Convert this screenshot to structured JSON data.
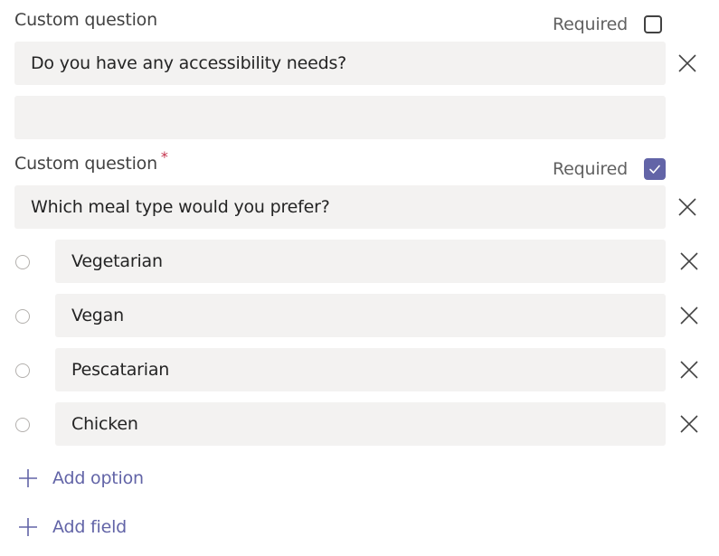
{
  "questions": [
    {
      "label": "Custom question",
      "required_marker": "",
      "required_label": "Required",
      "required_checked": false,
      "question_value": "Do you have any accessibility needs?",
      "answer_value": "",
      "close_icon": "close-icon"
    },
    {
      "label": "Custom question",
      "required_marker": "*",
      "required_label": "Required",
      "required_checked": true,
      "question_value": "Which meal type would you prefer?",
      "options": [
        {
          "label": "Vegetarian"
        },
        {
          "label": "Vegan"
        },
        {
          "label": "Pescatarian"
        },
        {
          "label": "Chicken"
        }
      ]
    }
  ],
  "actions": {
    "add_option_label": "Add option",
    "add_field_label": "Add field"
  },
  "colors": {
    "accent": "#6264a7",
    "field_bg": "#f3f2f1",
    "required_star": "#c4314b"
  }
}
